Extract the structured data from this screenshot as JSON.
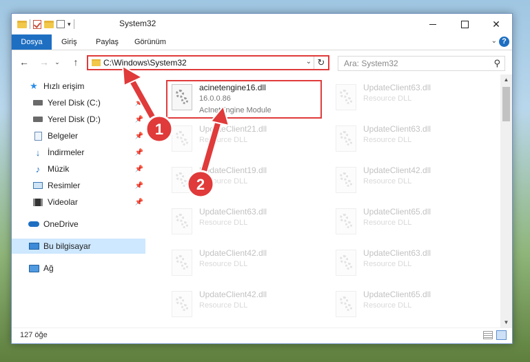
{
  "window": {
    "title": "System32"
  },
  "ribbon": {
    "tabs": [
      "Dosya",
      "Giriş",
      "Paylaş",
      "Görünüm"
    ],
    "help_label": "?"
  },
  "nav": {
    "back": "←",
    "forward": "→",
    "recent": "⌄",
    "up": "↑",
    "address": "C:\\Windows\\System32",
    "search_placeholder": "Ara: System32"
  },
  "sidebar": {
    "items": [
      {
        "label": "Hızlı erişim",
        "icon": "star-icon"
      },
      {
        "label": "Yerel Disk (C:)",
        "icon": "drive-icon",
        "pinned": true
      },
      {
        "label": "Yerel Disk (D:)",
        "icon": "drive-icon",
        "pinned": true
      },
      {
        "label": "Belgeler",
        "icon": "document-icon",
        "pinned": true
      },
      {
        "label": "İndirmeler",
        "icon": "download-icon",
        "pinned": true
      },
      {
        "label": "Müzik",
        "icon": "music-icon",
        "pinned": true
      },
      {
        "label": "Resimler",
        "icon": "pictures-icon",
        "pinned": true
      },
      {
        "label": "Videolar",
        "icon": "video-icon",
        "pinned": true
      },
      {
        "label": "OneDrive",
        "icon": "cloud-icon"
      },
      {
        "label": "Bu bilgisayar",
        "icon": "computer-icon",
        "selected": true
      },
      {
        "label": "Ağ",
        "icon": "network-icon"
      }
    ]
  },
  "files": {
    "highlighted": {
      "name": "acinetengine16.dll",
      "version": "16.0.0.86",
      "desc": "AcInetEngine Module"
    },
    "col1": [
      {
        "name": "UpdateClient21.dll",
        "desc": "Resource DLL"
      },
      {
        "name": "UpdateClient19.dll",
        "desc": "Resource DLL"
      },
      {
        "name": "UpdateClient63.dll",
        "desc": "Resource DLL"
      },
      {
        "name": "UpdateClient42.dll",
        "desc": "Resource DLL"
      },
      {
        "name": "UpdateClient42.dll",
        "desc": "Resource DLL"
      }
    ],
    "col2": [
      {
        "name": "UpdateClient63.dll",
        "desc": "Resource DLL"
      },
      {
        "name": "UpdateClient63.dll",
        "desc": "Resource DLL"
      },
      {
        "name": "UpdateClient42.dll",
        "desc": "Resource DLL"
      },
      {
        "name": "UpdateClient65.dll",
        "desc": "Resource DLL"
      },
      {
        "name": "UpdateClient63.dll",
        "desc": "Resource DLL"
      },
      {
        "name": "UpdateClient65.dll",
        "desc": "Resource DLL"
      }
    ]
  },
  "status": {
    "count": "127 öğe"
  },
  "annotations": {
    "step1": "1",
    "step2": "2",
    "color": "#e03a3a"
  }
}
